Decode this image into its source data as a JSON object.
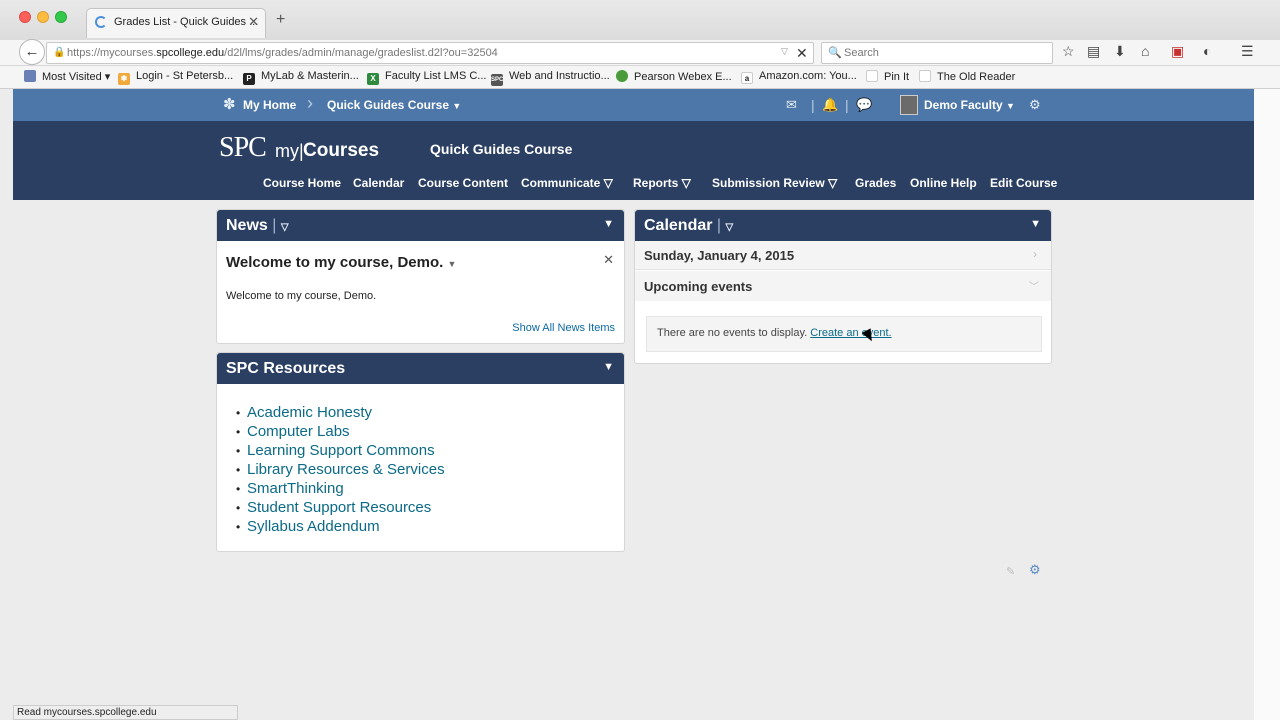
{
  "browser": {
    "tab_title": "Grades List - Quick Guides ...",
    "tab_close": "✕",
    "new_tab": "+",
    "url_prefix": "https://mycourses.",
    "url_domain": "spcollege.edu",
    "url_path": "/d2l/lms/grades/admin/manage/gradeslist.d2l?ou=32504",
    "search_placeholder": "Search",
    "status_text": "Read mycourses.spcollege.edu",
    "bookmarks": [
      {
        "label": "Most Visited ▾",
        "icon": "most-visited-icon",
        "color": "#6a7fb5"
      },
      {
        "label": "Login - St Petersb...",
        "icon": "spc-star-icon",
        "color": "#f2a93b"
      },
      {
        "label": "MyLab & Masterin...",
        "icon": "p-icon",
        "color": "#222"
      },
      {
        "label": "Faculty List LMS C...",
        "icon": "excel-icon",
        "color": "#2e8b3e"
      },
      {
        "label": "Web and Instructio...",
        "icon": "spc-icon",
        "color": "#555"
      },
      {
        "label": "Pearson Webex E...",
        "icon": "globe-icon",
        "color": "#4a9c3a"
      },
      {
        "label": "Amazon.com: You...",
        "icon": "amazon-icon",
        "color": "#222"
      },
      {
        "label": "Pin It",
        "icon": "page-icon",
        "color": "#ddd"
      },
      {
        "label": "The Old Reader",
        "icon": "page-icon",
        "color": "#ddd"
      }
    ]
  },
  "minibar": {
    "home_label": "My Home",
    "course_label": "Quick Guides Course",
    "user_label": "Demo Faculty"
  },
  "header": {
    "logo_spc": "SPC",
    "logo_my": "my|",
    "logo_courses": "Courses",
    "course_title": "Quick Guides Course",
    "nav": [
      "Course Home",
      "Calendar",
      "Course Content",
      "Communicate ▽",
      "Reports ▽",
      "Submission Review ▽",
      "Grades",
      "Online Help",
      "Edit Course"
    ]
  },
  "news": {
    "title": "News",
    "item_title": "Welcome to my course, Demo.",
    "item_body": "Welcome to my course, Demo.",
    "show_all": "Show All News Items"
  },
  "resources": {
    "title": "SPC Resources",
    "links": [
      "Academic Honesty",
      "Computer Labs",
      "Learning Support Commons",
      "Library Resources & Services",
      "SmartThinking",
      "Student Support Resources",
      "Syllabus Addendum"
    ]
  },
  "calendar": {
    "title": "Calendar",
    "date": "Sunday, January 4, 2015",
    "upcoming": "Upcoming events",
    "empty_text": "There are no events to display.",
    "create_link": "Create an event."
  }
}
